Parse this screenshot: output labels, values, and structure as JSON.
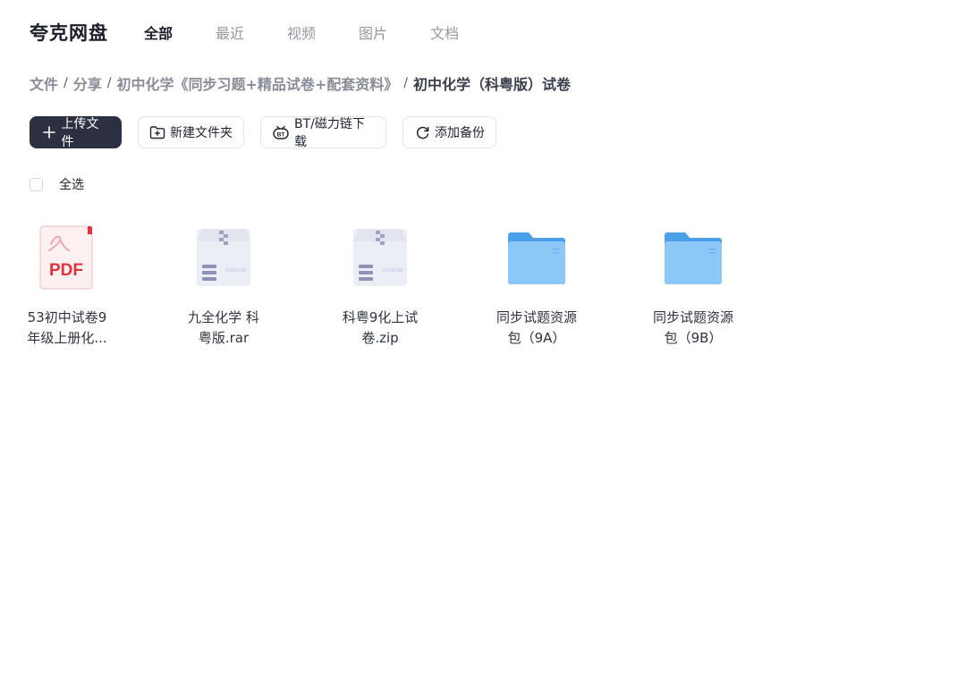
{
  "header": {
    "logo": "夸克网盘",
    "tabs": [
      {
        "label": "全部",
        "active": true
      },
      {
        "label": "最近",
        "active": false
      },
      {
        "label": "视频",
        "active": false
      },
      {
        "label": "图片",
        "active": false
      },
      {
        "label": "文档",
        "active": false
      }
    ]
  },
  "breadcrumb": {
    "items": [
      "文件",
      "分享",
      "初中化学《同步习题+精品试卷+配套资料》"
    ],
    "current": "初中化学（科粤版）试卷"
  },
  "toolbar": {
    "upload": "上传文件",
    "new_folder": "新建文件夹",
    "bt_download": "BT/磁力链下载",
    "add_backup": "添加备份"
  },
  "select_all": {
    "label": "全选"
  },
  "files": [
    {
      "type": "pdf",
      "name_line1": "53初中试卷9",
      "name_line2": "年级上册化..."
    },
    {
      "type": "archive",
      "name_line1": "九全化学 科",
      "name_line2": "粤版.rar"
    },
    {
      "type": "archive",
      "name_line1": "科粤9化上试",
      "name_line2": "卷.zip"
    },
    {
      "type": "folder",
      "name_line1": "同步试题资源",
      "name_line2": "包（9A）"
    },
    {
      "type": "folder",
      "name_line1": "同步试题资源",
      "name_line2": "包（9B）"
    }
  ],
  "colors": {
    "primary_button": "#2d3041",
    "folder": "#5aaef0",
    "pdf": "#e0323d"
  }
}
